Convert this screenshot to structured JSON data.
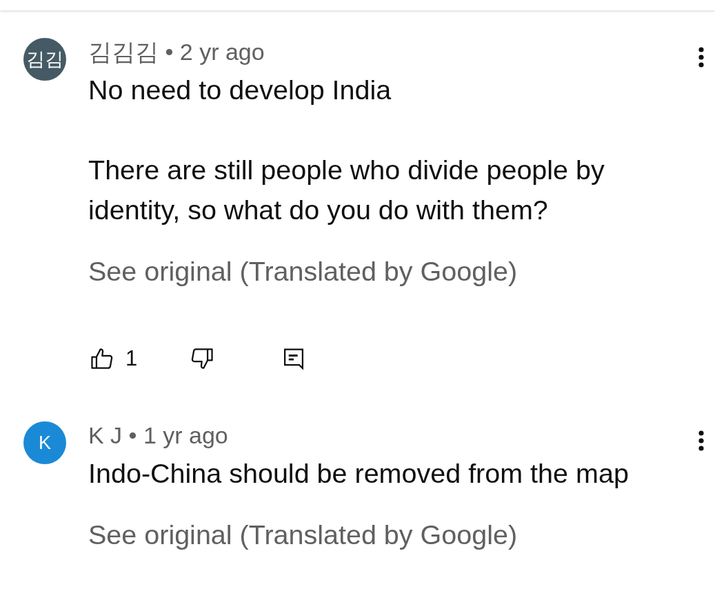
{
  "comments": [
    {
      "avatar": {
        "initials": "김김",
        "color": "#455a64"
      },
      "byline": "김김김 • 2 yr ago",
      "paragraphs": [
        "No need to develop India",
        "There are still people who divide people by identity, so what do you do with them?"
      ],
      "translation_link": "See original (Translated by Google)",
      "actions": {
        "likes": "1"
      }
    },
    {
      "avatar": {
        "initials": "K",
        "color": "#1a8ad6"
      },
      "byline": "K J • 1 yr ago",
      "paragraphs": [
        "Indo-China should be removed from the map"
      ],
      "translation_link": "See original (Translated by Google)"
    }
  ]
}
